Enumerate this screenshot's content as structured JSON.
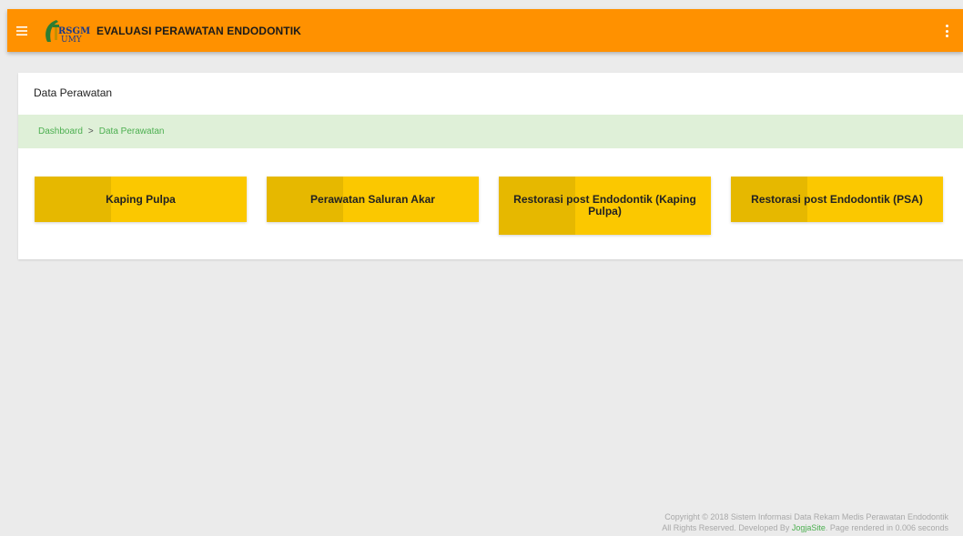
{
  "header": {
    "title": "EVALUASI PERAWATAN ENDODONTIK",
    "logo_text_top": "RSGM",
    "logo_text_bottom": "UMY",
    "menu_icon": "hamburger-icon",
    "more_icon": "more-vert-icon",
    "color": "#ff9100"
  },
  "card": {
    "title": "Data Perawatan"
  },
  "breadcrumb": {
    "items": [
      {
        "label": "Dashboard"
      },
      {
        "label": "Data Perawatan"
      }
    ],
    "separator": ">"
  },
  "tiles": [
    {
      "label": "Kaping Pulpa"
    },
    {
      "label": "Perawatan Saluran Akar"
    },
    {
      "label": "Restorasi post Endodontik (Kaping Pulpa)"
    },
    {
      "label": "Restorasi post Endodontik (PSA)"
    }
  ],
  "footer": {
    "line1": "Copyright © 2018 Sistem Informasi Data Rekam Medis Perawatan Endodontik",
    "line2_pre": "All Rights Reserved. Developed By ",
    "line2_link": "JogjaSite",
    "line2_post": ". Page rendered in 0.006 seconds"
  },
  "colors": {
    "tile": "#fbc800",
    "tile_accent": "#e6b800",
    "breadcrumb_bg": "#dff0d8",
    "link": "#4caf50"
  }
}
